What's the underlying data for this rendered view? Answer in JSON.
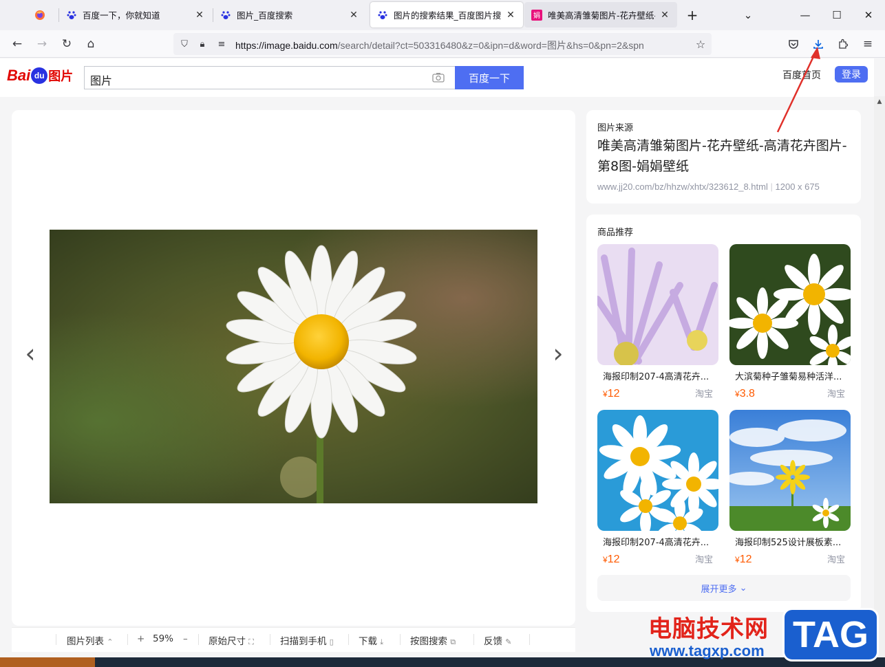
{
  "browser": {
    "tabs": [
      {
        "label": "",
        "icon": "firefox-icon"
      },
      {
        "label": "百度一下，你就知道",
        "icon": "baidu-paw-icon"
      },
      {
        "label": "图片_百度搜索",
        "icon": "baidu-paw-icon"
      },
      {
        "label": "图片的搜索结果_百度图片搜索",
        "icon": "baidu-paw-icon",
        "active": true
      },
      {
        "label": "唯美高清雏菊图片-花卉壁纸-高",
        "icon": "site-favicon",
        "favicon_text": "娟"
      }
    ],
    "url_host": "https://image.baidu.com",
    "url_path": "/search/detail?ct=503316480&z=0&ipn=d&word=图片&hs=0&pn=2&spn"
  },
  "baidu": {
    "logo_bai": "Bai",
    "logo_du": "du",
    "logo_tupian": "图片",
    "query": "图片",
    "search_button": "百度一下",
    "home_link": "百度首页",
    "login_button": "登录"
  },
  "viewer": {
    "toolbar": {
      "list": "图片列表",
      "zoom": "59%",
      "zoom_in": "+",
      "zoom_out": "–",
      "original_size": "原始尺寸",
      "scan_to_phone": "扫描到手机",
      "download": "下载",
      "search_by_image": "按图搜索",
      "feedback": "反馈"
    }
  },
  "source": {
    "label": "图片来源",
    "title": "唯美高清雏菊图片-花卉壁纸-高清花卉图片-第8图-娟娟壁纸",
    "domain_path": "www.jj20.com/bz/hhzw/xhtx/323612_8.html",
    "dimensions": "1200 x 675"
  },
  "recommend": {
    "label": "商品推荐",
    "products": [
      {
        "name": "海报印制207-4高清花卉...",
        "currency": "¥",
        "price": "12",
        "shop": "淘宝"
      },
      {
        "name": "大滨菊种子雏菊易种活洋...",
        "currency": "¥",
        "price": "3.8",
        "shop": "淘宝"
      },
      {
        "name": "海报印制207-4高清花卉...",
        "currency": "¥",
        "price": "12",
        "shop": "淘宝"
      },
      {
        "name": "海报印制525设计展板素...",
        "currency": "¥",
        "price": "12",
        "shop": "淘宝"
      }
    ],
    "more": "展开更多"
  },
  "watermark": {
    "line1": "电脑技术网",
    "line2": "www.tagxp.com",
    "badge": "TAG"
  },
  "colors": {
    "baidu_blue": "#4e6ef2",
    "price_orange": "#ff5a00",
    "annotation_red": "#e0302a"
  }
}
